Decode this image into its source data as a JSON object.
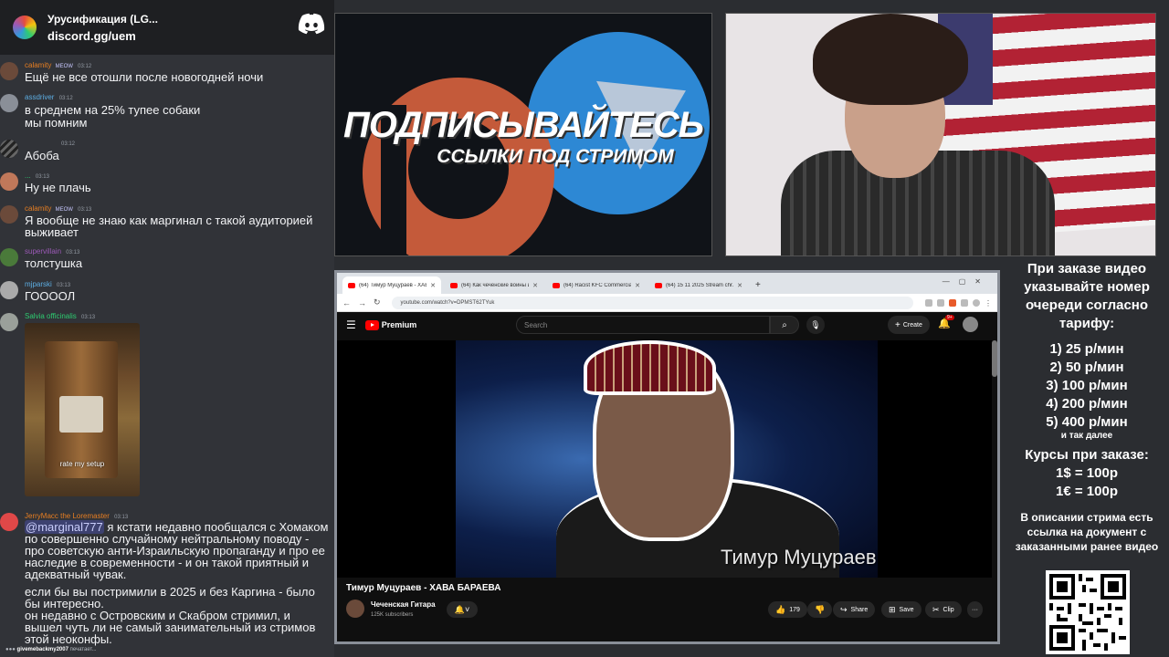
{
  "chat": {
    "server_title": "Урусификация (LG...",
    "server_invite": "discord.gg/uem",
    "messages": [
      {
        "user": "calamity",
        "badge": "MEOW",
        "time": "03:12",
        "text": "Ещё не все отошли после новогодней ночи",
        "color": "#e67e22"
      },
      {
        "user": "assdriver",
        "badge": "",
        "time": "03:12",
        "text": "в среднем на 25% тупее собаки",
        "text2": "мы помним",
        "color": "#5dade2"
      },
      {
        "user": "",
        "badge": "",
        "time": "03:12",
        "text": "Абоба",
        "color": "#cccccc"
      },
      {
        "user": "...",
        "badge": "",
        "time": "03:13",
        "text": "Ну не плачь",
        "color": "#2ecc71"
      },
      {
        "user": "calamity",
        "badge": "MEOW",
        "time": "03:13",
        "text": "Я вообще не знаю как маргинал с такой аудиторией выживает",
        "color": "#e67e22"
      },
      {
        "user": "supervillain",
        "badge": "",
        "time": "03:13",
        "text": "толстушка",
        "color": "#9b59b6"
      },
      {
        "user": "mjparski",
        "badge": "",
        "time": "03:13",
        "text": "ГООООЛ",
        "color": "#5dade2"
      },
      {
        "user": "Salvia officinalis",
        "badge": "",
        "time": "03:13",
        "text": "",
        "color": "#2ecc71"
      },
      {
        "user": "JerryMacc the Loremaster",
        "badge": "",
        "time": "03:13",
        "mention": "@marginal777",
        "text": " я кстати недавно пообщался с Хомаком по совершенно случайному нейтральному поводу - про советскую анти-Израильскую пропаганду и про ее наследие в современности - и он такой приятный и адекватный чувак.",
        "text2": "если бы вы постримили в 2025 и без Каргина - было бы интересно.",
        "text3": "он недавно с Островским и Скабром стримил, и вышел  чуть ли не самый занимательный из стримов этой неоконфы.",
        "color": "#e67e22"
      }
    ],
    "image_caption": "rate my setup",
    "typing_user": "givemebackmy2007",
    "typing_suffix": " печатает..."
  },
  "promo": {
    "title": "ПОДПИСЫВАЙТЕСЬ",
    "subtitle": "ССЫЛКИ ПОД СТРИМОМ"
  },
  "browser": {
    "tabs": [
      {
        "title": "(64) Тимур Муцураев - ХАВ...",
        "active": true
      },
      {
        "title": "(64) Как чеченские войны и...",
        "active": false
      },
      {
        "title": "(64) Racist KFC Commercial...",
        "active": false
      },
      {
        "title": "(64) 15 11 2025 Stream chr...",
        "active": false
      }
    ],
    "url": "youtube.com/watch?v=DPMST62TYuk",
    "youtube": {
      "logo_text": "Premium",
      "search_placeholder": "Search",
      "create_label": "Create",
      "notif_count": "9+",
      "video_caption": "Тимур Муцураев",
      "video_title": "Тимур Муцураев - ХАВА БАРАЕВА",
      "channel_name": "Чеченская Гитара",
      "channel_subs": "125K subscribers",
      "likes": "179",
      "share_label": "Share",
      "save_label": "Save",
      "clip_label": "Clip",
      "more_label": "···"
    }
  },
  "info": {
    "head_lines": [
      "При заказе видео",
      "указывайте номер",
      "очереди согласно",
      "тарифу:"
    ],
    "tariffs": [
      "1) 25 р/мин",
      "2) 50 р/мин",
      "3) 100 р/мин",
      "4) 200 р/мин",
      "5) 400 р/мин"
    ],
    "tariff_more": "и так далее",
    "courses_title": "Курсы при заказе:",
    "rates": [
      "1$ = 100р",
      "1€ = 100р"
    ],
    "doc_note": "В описании стрима есть ссылка на документ с заказанными ранее видео"
  }
}
